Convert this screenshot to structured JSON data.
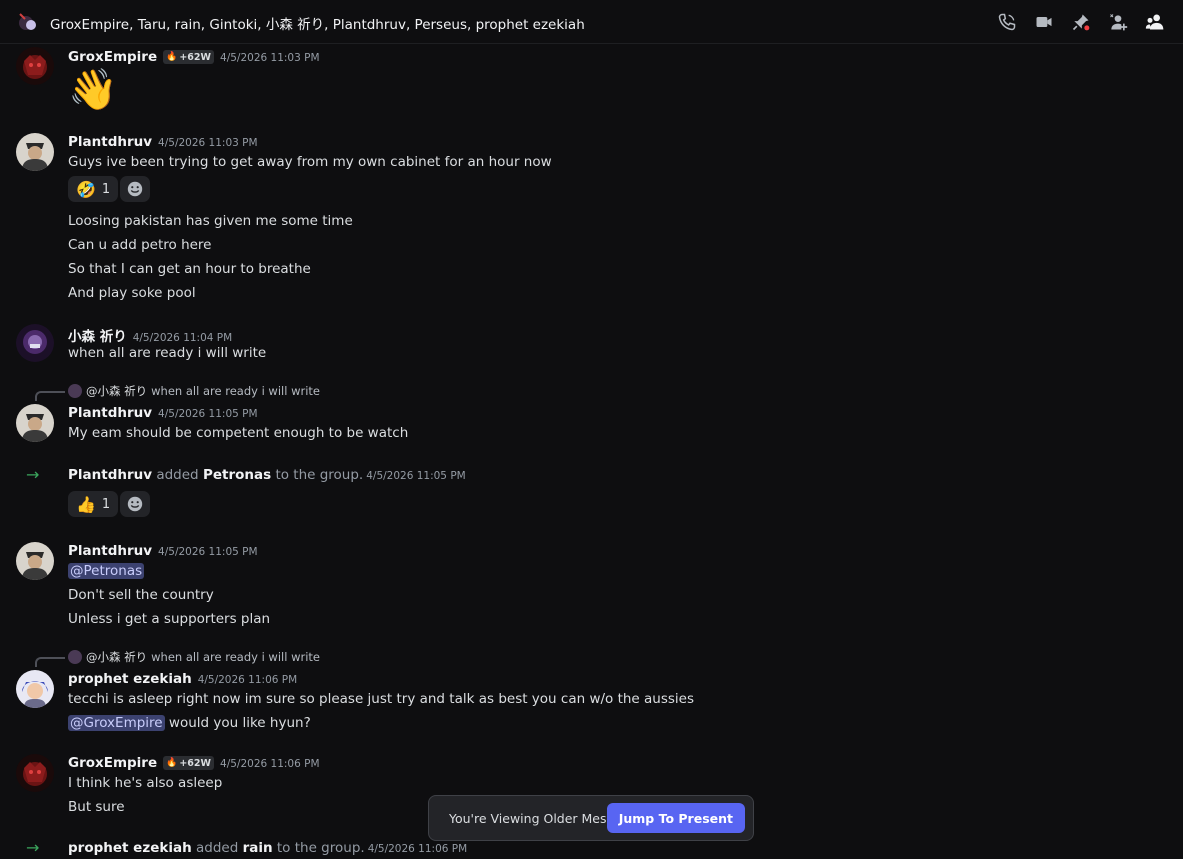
{
  "header": {
    "title": "GroxEmpire, Taru, rain, Gintoki, 小森 祈り, Plantdhruv, Perseus, prophet ezekiah",
    "tools": [
      "phone-call-icon",
      "video-call-icon",
      "pinned-messages-icon",
      "add-friends-icon",
      "member-list-icon"
    ]
  },
  "messages": {
    "m1": {
      "author": "GroxEmpire",
      "clan_tag": "+62W",
      "timestamp": "4/5/2026 11:03 PM",
      "emoji": "👋"
    },
    "m2": {
      "author": "Plantdhruv",
      "timestamp": "4/5/2026 11:03 PM",
      "lines": [
        "Guys ive been trying to get away from my own cabinet for an hour now",
        "Loosing pakistan has given me some time",
        "Can u add petro here",
        "So that I can get an hour to breathe",
        "And play soke pool"
      ],
      "reaction": {
        "emoji": "🤣",
        "count": "1"
      }
    },
    "m3": {
      "author": "小森 祈り",
      "timestamp": "4/5/2026 11:04 PM",
      "lines": [
        "when all are ready i will write"
      ]
    },
    "m4": {
      "reply_to": {
        "author": "@小森 祈り",
        "text": "when all are ready i will write"
      },
      "author": "Plantdhruv",
      "timestamp": "4/5/2026 11:05 PM",
      "lines": [
        "My eam should be competent enough to be watch"
      ]
    },
    "sys1": {
      "actor": "Plantdhruv",
      "verb": "added",
      "target": "Petronas",
      "suffix": "to the group.",
      "timestamp": "4/5/2026 11:05 PM",
      "reaction": {
        "emoji": "👍",
        "count": "1"
      }
    },
    "m5": {
      "author": "Plantdhruv",
      "timestamp": "4/5/2026 11:05 PM",
      "mention": "@Petronas",
      "lines": [
        "Don't sell the country",
        "Unless i get a supporters plan"
      ]
    },
    "m6": {
      "reply_to": {
        "author": "@小森 祈り",
        "text": "when all are ready i will write"
      },
      "author": "prophet ezekiah",
      "timestamp": "4/5/2026 11:06 PM",
      "lines": [
        "tecchi is asleep right now im sure so please just try and talk as best you can w/o the aussies"
      ],
      "mention": "@GroxEmpire",
      "mention_rest": "would you like hyun?"
    },
    "m7": {
      "author": "GroxEmpire",
      "clan_tag": "+62W",
      "timestamp": "4/5/2026 11:06 PM",
      "lines": [
        "I think he's also asleep",
        "But sure"
      ]
    },
    "sys2": {
      "actor": "prophet ezekiah",
      "verb": "added",
      "target": "rain",
      "suffix": "to the group.",
      "timestamp": "4/5/2026 11:06 PM"
    }
  },
  "older_bar": {
    "label": "You're Viewing Older Messages",
    "button": "Jump To Present"
  },
  "colors": {
    "accent": "#5865f2",
    "system_arrow": "#3ba55d",
    "mention_bg": "#3c4270"
  }
}
